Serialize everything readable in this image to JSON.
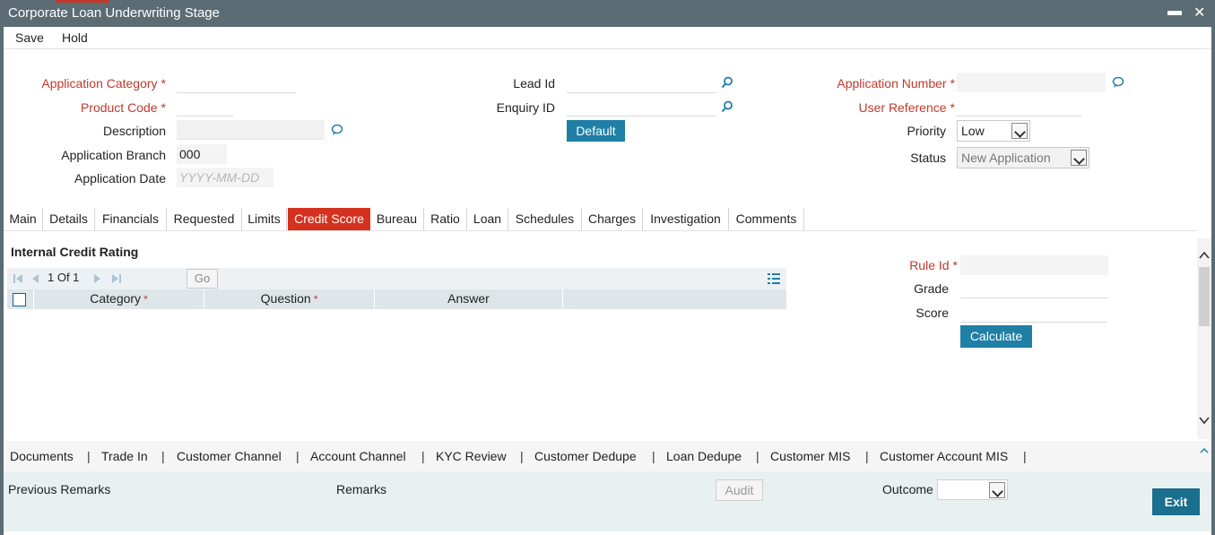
{
  "window": {
    "title": "Corporate Loan Underwriting Stage",
    "minimize": "▬",
    "close": "✕"
  },
  "menu": {
    "save": "Save",
    "hold": "Hold"
  },
  "form": {
    "application_category": {
      "label": "Application Category",
      "value": ""
    },
    "product_code": {
      "label": "Product Code",
      "value": ""
    },
    "description": {
      "label": "Description",
      "value": ""
    },
    "application_branch": {
      "label": "Application Branch",
      "value": "000"
    },
    "application_date": {
      "label": "Application Date",
      "value": "",
      "placeholder": "YYYY-MM-DD"
    },
    "lead_id": {
      "label": "Lead Id",
      "value": ""
    },
    "enquiry_id": {
      "label": "Enquiry ID",
      "value": ""
    },
    "default_button": "Default",
    "application_number": {
      "label": "Application Number",
      "value": ""
    },
    "user_reference": {
      "label": "User Reference",
      "value": ""
    },
    "priority": {
      "label": "Priority",
      "value": "Low"
    },
    "status": {
      "label": "Status",
      "value": "New Application"
    }
  },
  "required_mark": "*",
  "tabs": [
    "Main",
    "Details",
    "Financials",
    "Requested",
    "Limits",
    "Credit Score",
    "Bureau",
    "Ratio",
    "Loan",
    "Schedules",
    "Charges",
    "Investigation",
    "Comments"
  ],
  "active_tab": "Credit Score",
  "credit": {
    "section_title": "Internal Credit Rating",
    "pager": {
      "text": "1 Of 1",
      "go": "Go"
    },
    "columns": [
      "Category",
      "Question",
      "Answer"
    ],
    "rule_id": {
      "label": "Rule Id",
      "value": ""
    },
    "grade": {
      "label": "Grade",
      "value": ""
    },
    "score": {
      "label": "Score",
      "value": ""
    },
    "calculate": "Calculate"
  },
  "footer_links": [
    "Documents",
    "Trade In",
    "Customer Channel",
    "Account Channel",
    "KYC Review",
    "Customer Dedupe",
    "Loan Dedupe",
    "Customer MIS",
    "Customer Account MIS"
  ],
  "footer_sep": "|",
  "bottom": {
    "previous_remarks": "Previous Remarks",
    "remarks": "Remarks",
    "audit": "Audit",
    "outcome": {
      "label": "Outcome",
      "value": ""
    },
    "exit": "Exit"
  },
  "colors": {
    "title_bar": "#5b6c74",
    "active_tab": "#d4321e",
    "button": "#1f7fa5",
    "required": "#c0392b"
  }
}
